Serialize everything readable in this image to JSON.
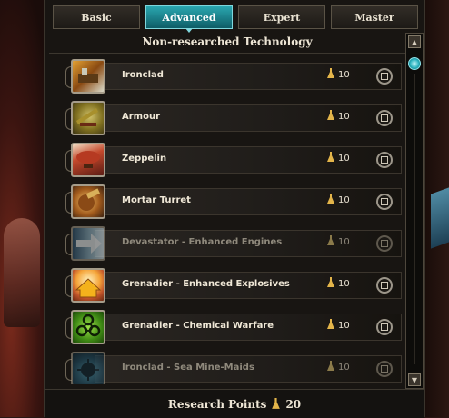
{
  "tabs": [
    {
      "label": "Basic"
    },
    {
      "label": "Advanced"
    },
    {
      "label": "Expert"
    },
    {
      "label": "Master"
    }
  ],
  "panel": {
    "title": "Non-researched Technology"
  },
  "technologies": [
    {
      "name": "Ironclad",
      "cost": "10",
      "available": true,
      "icon": "ironclad-icon"
    },
    {
      "name": "Armour",
      "cost": "10",
      "available": true,
      "icon": "armour-icon"
    },
    {
      "name": "Zeppelin",
      "cost": "10",
      "available": true,
      "icon": "zeppelin-icon"
    },
    {
      "name": "Mortar Turret",
      "cost": "10",
      "available": true,
      "icon": "mortar-turret-icon"
    },
    {
      "name": "Devastator - Enhanced Engines",
      "cost": "10",
      "available": false,
      "icon": "enhanced-engines-icon"
    },
    {
      "name": "Grenadier - Enhanced Explosives",
      "cost": "10",
      "available": true,
      "icon": "enhanced-explosives-icon"
    },
    {
      "name": "Grenadier - Chemical Warfare",
      "cost": "10",
      "available": true,
      "icon": "biohazard-icon"
    },
    {
      "name": "Ironclad - Sea Mine-Maids",
      "cost": "10",
      "available": false,
      "icon": "sea-mine-icon"
    }
  ],
  "footer": {
    "label": "Research Points",
    "value": "20"
  },
  "colors": {
    "accent": "#2aa7b0",
    "text": "#efe7d6",
    "dim_text": "#8f897c",
    "panel_bg": "#181512"
  }
}
